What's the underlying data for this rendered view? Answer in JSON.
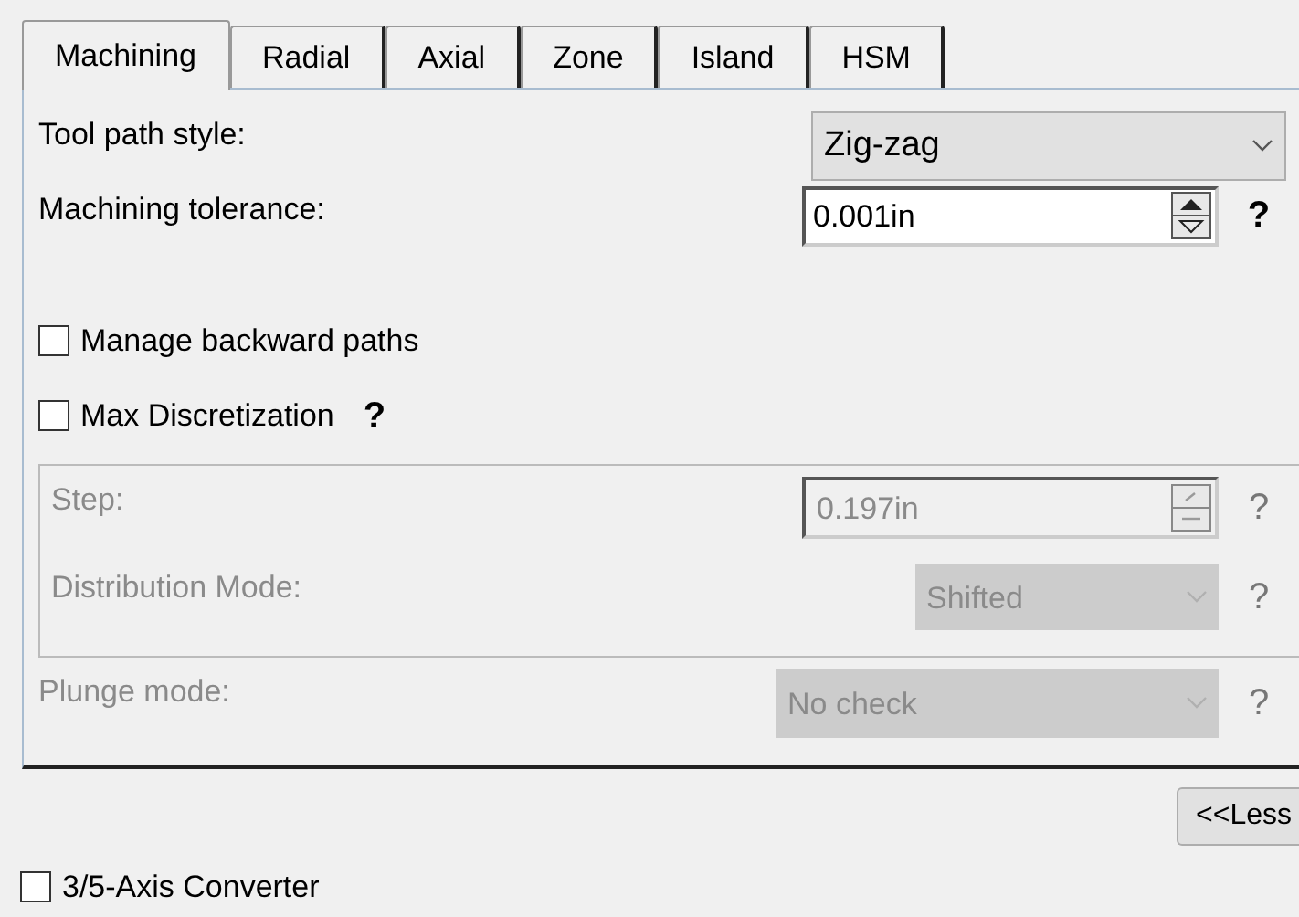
{
  "tabs": [
    {
      "label": "Machining",
      "selected": true
    },
    {
      "label": "Radial",
      "selected": false
    },
    {
      "label": "Axial",
      "selected": false
    },
    {
      "label": "Zone",
      "selected": false
    },
    {
      "label": "Island",
      "selected": false
    },
    {
      "label": "HSM",
      "selected": false
    }
  ],
  "tool_path_style": {
    "label": "Tool path style:",
    "value": "Zig-zag"
  },
  "machining_tolerance": {
    "label": "Machining tolerance:",
    "value": "0.001in",
    "help": "?"
  },
  "checkboxes": [
    {
      "label": "Manage backward paths",
      "checked": false
    },
    {
      "label": "Max Discretization",
      "checked": false,
      "help": "?"
    }
  ],
  "group": {
    "disabled": true,
    "step": {
      "label": "Step:",
      "value": "0.197in",
      "help": "?"
    },
    "distribution_mode": {
      "label": "Distribution Mode:",
      "value": "Shifted",
      "help": "?"
    }
  },
  "plunge_mode": {
    "label": "Plunge mode:",
    "value": "No check",
    "help": "?",
    "disabled": true
  },
  "less_button": "<<Less",
  "axis_converter": {
    "label": "3/5-Axis Converter",
    "checked": false
  }
}
